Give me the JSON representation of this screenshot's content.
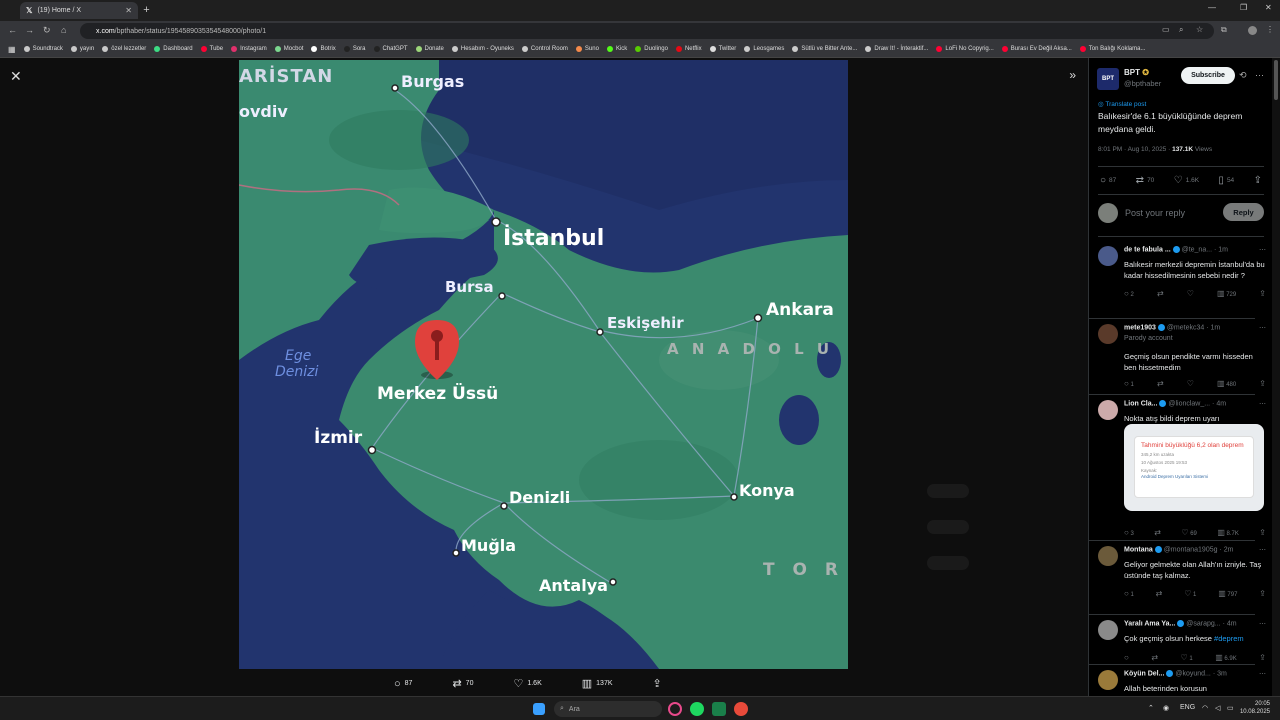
{
  "browser": {
    "tab_title": "(19) Home / X",
    "url_host": "x.com",
    "url_path": "/bpthaber/status/1954589035354548000/photo/1",
    "bookmarks": [
      {
        "label": "Soundtrack",
        "color": "#c9c9c9"
      },
      {
        "label": "yayın",
        "color": "#c9c9c9"
      },
      {
        "label": "özel lezzetler",
        "color": "#c9c9c9"
      },
      {
        "label": "Dashboard",
        "color": "#3ddc84"
      },
      {
        "label": "Tube",
        "color": "#ff0033"
      },
      {
        "label": "Instagram",
        "color": "#e1306c"
      },
      {
        "label": "Mocbot",
        "color": "#7bd88f"
      },
      {
        "label": "Botrix",
        "color": "#ffffff"
      },
      {
        "label": "Sora",
        "color": "#222222"
      },
      {
        "label": "ChatGPT",
        "color": "#222222"
      },
      {
        "label": "Donate",
        "color": "#9cd67a"
      },
      {
        "label": "Hesabım - Oyuneks",
        "color": "#cccccc"
      },
      {
        "label": "Control Room",
        "color": "#cccccc"
      },
      {
        "label": "Suno",
        "color": "#f48a4b"
      },
      {
        "label": "Kick",
        "color": "#53fc18"
      },
      {
        "label": "Duolingo",
        "color": "#58cc02"
      },
      {
        "label": "Netflix",
        "color": "#e50914"
      },
      {
        "label": "Twitter",
        "color": "#dddddd"
      },
      {
        "label": "Leosgames",
        "color": "#cccccc"
      },
      {
        "label": "Sütlü ve Bitter Ante...",
        "color": "#cccccc"
      },
      {
        "label": "Draw It! - İnteraktif...",
        "color": "#cccccc"
      },
      {
        "label": "LoFi No Copyrig...",
        "color": "#ff0033"
      },
      {
        "label": "Burası Ev Değil Aksa...",
        "color": "#ff0033"
      },
      {
        "label": "Ton Balığı Koklama...",
        "color": "#ff0033"
      }
    ]
  },
  "map": {
    "labels": {
      "aristan": "ARİSTAN",
      "burgas": "Burgas",
      "plovdiv": "ovdiv",
      "istanbul": "İstanbul",
      "bursa": "Bursa",
      "eskisehir": "Eskişehir",
      "ankara": "Ankara",
      "anadolu": "A N A D O L U",
      "ege1": "Ege",
      "ege2": "Denizi",
      "merkez": "Merkez Üssü",
      "izmir": "İzmir",
      "denizli": "Denizli",
      "konya": "Konya",
      "mugla": "Muğla",
      "antalya": "Antalya",
      "toros": "T O R"
    }
  },
  "media_actions": {
    "replies": "87",
    "reposts": "70",
    "likes": "1.6K",
    "views": "137K"
  },
  "post": {
    "author_name": "BPT",
    "author_handle": "@bpthaber",
    "avatar_text": "BPT",
    "subscribe_label": "Subscribe",
    "translate_label": "Translate post",
    "text": "Balıkesir'de 6.1 büyüklüğünde deprem meydana geldi.",
    "time": "8:01 PM · Aug 10, 2025 · ",
    "views_count": "137.1K",
    "views_label": " Views",
    "stats": {
      "replies": "87",
      "reposts": "70",
      "likes": "1.6K",
      "bookmarks": "54"
    },
    "reply_placeholder": "Post your reply",
    "reply_button": "Reply"
  },
  "replies": [
    {
      "name": "de te fabula ...",
      "handle": "@te_na... · 1m",
      "parody": "",
      "text": "Balıkesir merkezli depremin İstanbul'da bu kadar hissedilmesinin sebebi nedir ?",
      "replies": "2",
      "reposts": "",
      "likes": "",
      "views": "729",
      "avatar_color": "#4a5a8a"
    },
    {
      "name": "mete1903",
      "handle": "@metekc34 · 1m",
      "parody": "Parody account",
      "text": "Geçmiş olsun pendikte varmı hisseden ben hissetmedim",
      "replies": "1",
      "reposts": "",
      "likes": "",
      "views": "480",
      "avatar_color": "#5a3a2a"
    },
    {
      "name": "Lion Cla...",
      "handle": "@lionclaw_... · 4m",
      "parody": "",
      "text": "Nokta atış bildi deprem uyarı",
      "replies": "3",
      "reposts": "",
      "likes": "69",
      "views": "8.7K",
      "avatar_color": "#caa",
      "card": {
        "title": "Tahmini büyüklüğü 6,2 olan deprem",
        "line1": "345,2 km uzakta",
        "line2": "10 Ağustos 2025 19:53",
        "line3": "Kaynak:",
        "line4": "Android Deprem Uyarıları Sistemi"
      }
    },
    {
      "name": "Montana",
      "handle": "@montana1905g · 2m",
      "parody": "",
      "text": "Geliyor gelmekte olan Allah'ın izniyle. Taş üstünde taş kalmaz.",
      "replies": "1",
      "reposts": "",
      "likes": "1",
      "views": "797",
      "avatar_color": "#6b5a3a"
    },
    {
      "name": "Yaralı Ama Ya...",
      "handle": "@sarapg... · 4m",
      "parody": "",
      "text": "Çok geçmiş olsun herkese ",
      "tag": "#deprem",
      "replies": "",
      "reposts": "",
      "likes": "1",
      "views": "6.9K",
      "avatar_color": "#8a8a8a"
    },
    {
      "name": "Köyün Del...",
      "handle": "@koyund... · 3m",
      "parody": "",
      "text": "Allah beterinden korusun",
      "replies": "",
      "reposts": "",
      "likes": "",
      "views": "",
      "avatar_color": "#9a7a3a"
    }
  ],
  "taskbar": {
    "search_placeholder": "Ara",
    "lang": "ENG",
    "time": "20:05",
    "date": "10.08.2025"
  }
}
